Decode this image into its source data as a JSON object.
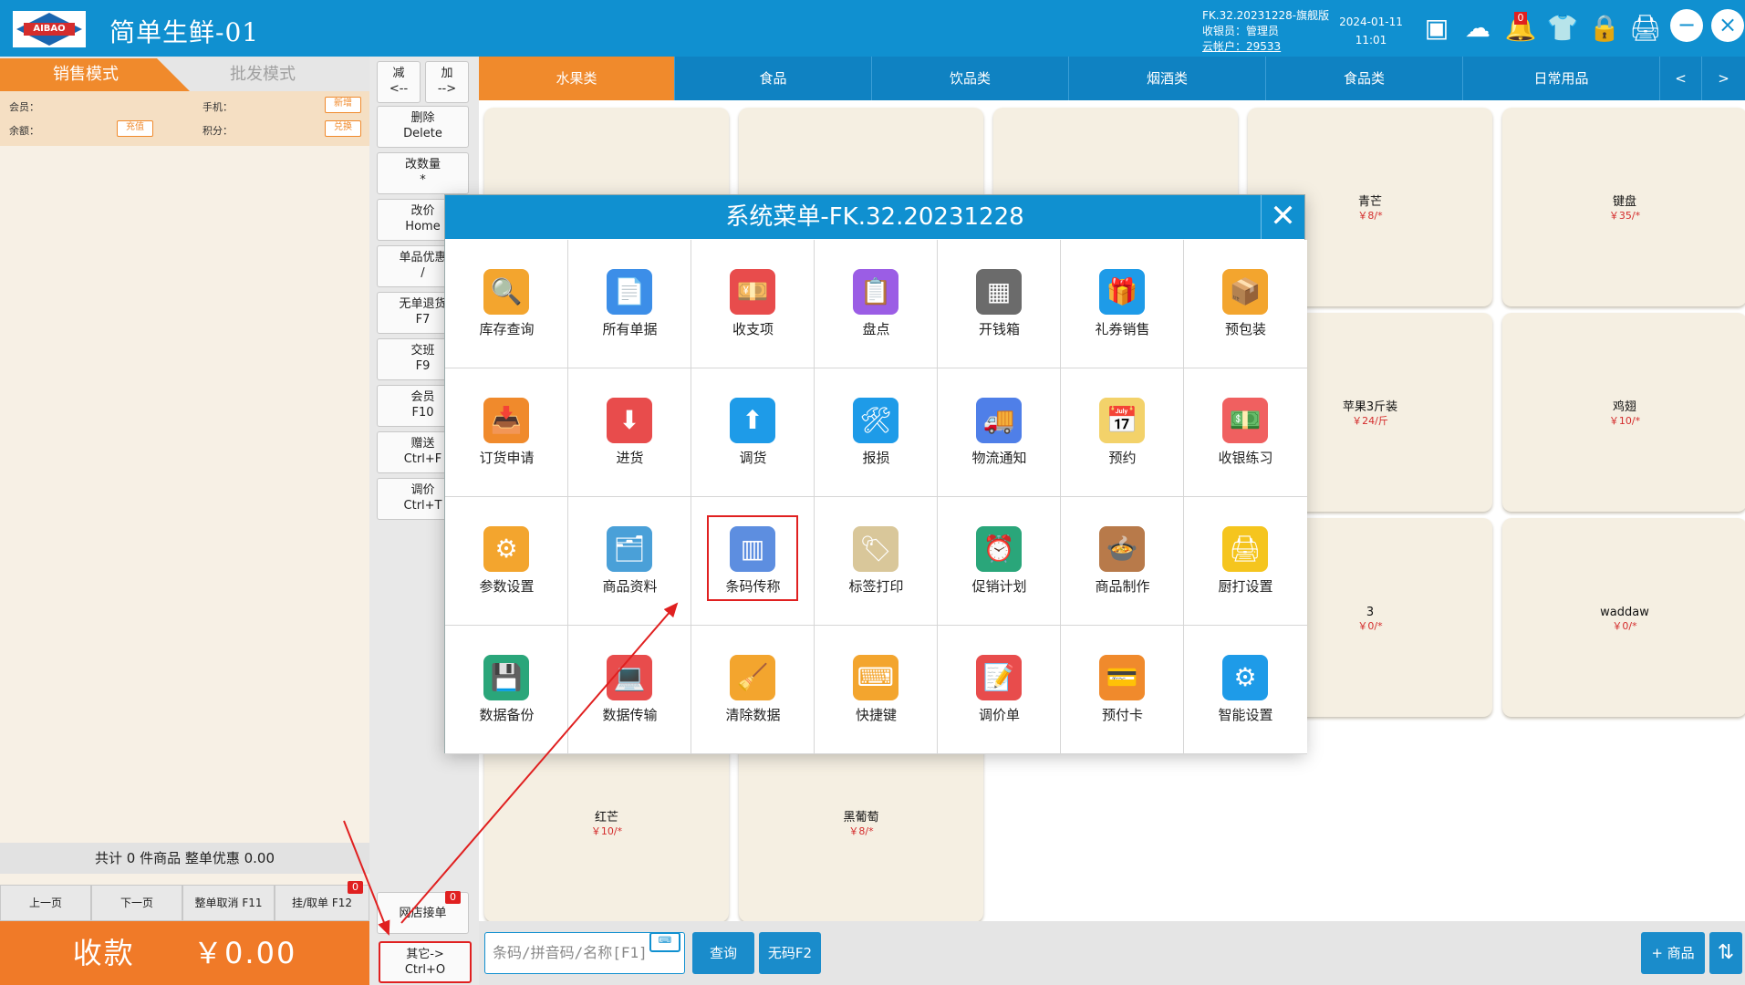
{
  "header": {
    "app_title": "简单生鲜-01",
    "logo_text": "AIBAO",
    "version": "FK.32.20231228-旗舰版",
    "cashier": "收银员：管理员",
    "cloud_account": "云帐户：29533",
    "date": "2024-01-11",
    "time": "11:01",
    "notification_count": "0"
  },
  "left": {
    "tab_sale": "销售模式",
    "tab_wholesale": "批发模式",
    "member_label": "会员：",
    "phone_label": "手机：",
    "balance_label": "余额：",
    "points_label": "积分：",
    "btn_new": "新增",
    "btn_recharge": "充值",
    "btn_redeem": "兑换",
    "summary": "共计 0 件商品 整单优惠 0.00",
    "pager": [
      "上一页",
      "下一页",
      "整单取消 F11",
      "挂/取单 F12"
    ],
    "hold_count": "0",
    "pay_label": "收款",
    "pay_amount": "￥0.00"
  },
  "keys": {
    "minus_top": "减",
    "minus_bottom": "<--",
    "plus_top": "加",
    "plus_bottom": "-->",
    "delete_top": "删除",
    "delete_bottom": "Delete",
    "qty_top": "改数量",
    "qty_bottom": "*",
    "price_top": "改价",
    "price_bottom": "Home",
    "discount_top": "单品优惠",
    "discount_bottom": "/",
    "refund_top": "无单退货",
    "refund_bottom": "F7",
    "shift_top": "交班",
    "shift_bottom": "F9",
    "member_top": "会员",
    "member_bottom": "F10",
    "gift_top": "赠送",
    "gift_bottom": "Ctrl+F",
    "adjust_top": "调价",
    "adjust_bottom": "Ctrl+T",
    "online_order": "网店接单",
    "online_count": "0",
    "other_top": "其它->",
    "other_bottom": "Ctrl+O"
  },
  "categories": [
    "水果类",
    "食品",
    "饮品类",
    "烟酒类",
    "食品类",
    "日常用品"
  ],
  "cat_prev": "<",
  "cat_next": ">",
  "products": [
    {
      "name": "青芒",
      "price": "￥8/*"
    },
    {
      "name": "键盘",
      "price": "￥35/*"
    },
    {
      "name": "苹果3斤装",
      "price": "￥24/斤"
    },
    {
      "name": "鸡翅",
      "price": "￥10/*"
    },
    {
      "name": "3",
      "price": "￥0/*"
    },
    {
      "name": "waddaw",
      "price": "￥0/*"
    },
    {
      "name": "红芒",
      "price": "￥10/*"
    },
    {
      "name": "黑葡萄",
      "price": "￥8/*"
    }
  ],
  "bottom": {
    "search_placeholder": "条码/拼音码/名称[F1]",
    "query": "查询",
    "no_code": "无码F2",
    "add_product": "+ 商品"
  },
  "modal": {
    "title": "系统菜单-FK.32.20231228",
    "items": [
      {
        "label": "库存查询",
        "icon": "inventory-search-icon",
        "color": "#f3a52e",
        "glyph": "🔍"
      },
      {
        "label": "所有单据",
        "icon": "documents-icon",
        "color": "#3c8ee8",
        "glyph": "📄"
      },
      {
        "label": "收支项",
        "icon": "income-expense-icon",
        "color": "#e84c4c",
        "glyph": "💴"
      },
      {
        "label": "盘点",
        "icon": "stocktake-icon",
        "color": "#9b5de5",
        "glyph": "📋"
      },
      {
        "label": "开钱箱",
        "icon": "cash-drawer-icon",
        "color": "#6b6b6b",
        "glyph": "▦"
      },
      {
        "label": "礼券销售",
        "icon": "gift-voucher-icon",
        "color": "#1e9be8",
        "glyph": "🎁"
      },
      {
        "label": "预包装",
        "icon": "prepackage-icon",
        "color": "#f3a52e",
        "glyph": "📦"
      },
      {
        "label": "订货申请",
        "icon": "order-request-icon",
        "color": "#f08a2c",
        "glyph": "📥"
      },
      {
        "label": "进货",
        "icon": "purchase-icon",
        "color": "#e84c4c",
        "glyph": "⬇"
      },
      {
        "label": "调货",
        "icon": "transfer-icon",
        "color": "#1e9be8",
        "glyph": "⬆"
      },
      {
        "label": "报损",
        "icon": "loss-report-icon",
        "color": "#1e9be8",
        "glyph": "🛠"
      },
      {
        "label": "物流通知",
        "icon": "logistics-icon",
        "color": "#4f7fe8",
        "glyph": "🚚"
      },
      {
        "label": "预约",
        "icon": "reservation-icon",
        "color": "#f3d26a",
        "glyph": "📅"
      },
      {
        "label": "收银练习",
        "icon": "cashier-practice-icon",
        "color": "#f06060",
        "glyph": "💵"
      },
      {
        "label": "参数设置",
        "icon": "settings-gears-icon",
        "color": "#f3a52e",
        "glyph": "⚙"
      },
      {
        "label": "商品资料",
        "icon": "product-info-icon",
        "color": "#4aa0d8",
        "glyph": "🗂"
      },
      {
        "label": "条码传称",
        "icon": "barcode-scale-icon",
        "color": "#5d8ee0",
        "glyph": "▥"
      },
      {
        "label": "标签打印",
        "icon": "label-print-icon",
        "color": "#d9c79a",
        "glyph": "🏷"
      },
      {
        "label": "促销计划",
        "icon": "promotion-plan-icon",
        "color": "#2aa67a",
        "glyph": "⏰"
      },
      {
        "label": "商品制作",
        "icon": "product-make-icon",
        "color": "#b87a4a",
        "glyph": "🍲"
      },
      {
        "label": "厨打设置",
        "icon": "kitchen-print-icon",
        "color": "#f5c51e",
        "glyph": "🖨"
      },
      {
        "label": "数据备份",
        "icon": "data-backup-icon",
        "color": "#2aa67a",
        "glyph": "💾"
      },
      {
        "label": "数据传输",
        "icon": "data-transfer-icon",
        "color": "#e84c4c",
        "glyph": "💻"
      },
      {
        "label": "清除数据",
        "icon": "clear-data-icon",
        "color": "#f3a52e",
        "glyph": "🧹"
      },
      {
        "label": "快捷键",
        "icon": "shortcut-keys-icon",
        "color": "#f3a52e",
        "glyph": "⌨"
      },
      {
        "label": "调价单",
        "icon": "price-adjust-icon",
        "color": "#e84c4c",
        "glyph": "📝"
      },
      {
        "label": "预付卡",
        "icon": "prepaid-card-icon",
        "color": "#f08a2c",
        "glyph": "💳"
      },
      {
        "label": "智能设置",
        "icon": "smart-settings-icon",
        "color": "#1e9be8",
        "glyph": "⚙"
      }
    ]
  },
  "colors": {
    "header": "#1090d0",
    "accent": "#f08a2c",
    "highlight": "#e02020"
  }
}
